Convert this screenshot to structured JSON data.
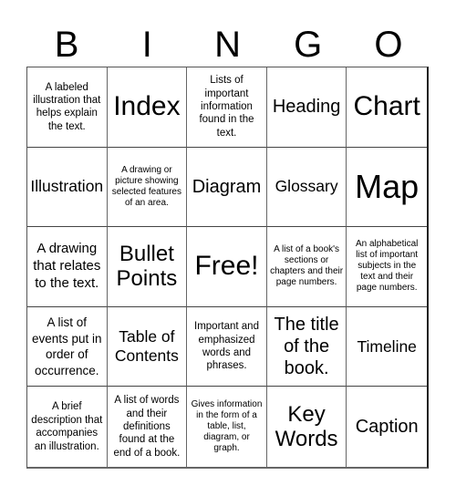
{
  "header": {
    "letters": [
      "B",
      "I",
      "N",
      "G",
      "O"
    ]
  },
  "cells": [
    {
      "text": "A labeled illustration that helps explain the text.",
      "size": "sz-s"
    },
    {
      "text": "Index",
      "size": "sz-xxl"
    },
    {
      "text": "Lists of important information found in the text.",
      "size": "sz-s"
    },
    {
      "text": "Heading",
      "size": "sz-lx"
    },
    {
      "text": "Chart",
      "size": "sz-xxl"
    },
    {
      "text": "Illustration",
      "size": "sz-l"
    },
    {
      "text": "A drawing or picture showing selected features of an area.",
      "size": "sz-xs"
    },
    {
      "text": "Diagram",
      "size": "sz-lx"
    },
    {
      "text": "Glossary",
      "size": "sz-l"
    },
    {
      "text": "Map",
      "size": "sz-xxxl"
    },
    {
      "text": "A drawing that relates to the text.",
      "size": "sz-ml"
    },
    {
      "text": "Bullet Points",
      "size": "sz-xl"
    },
    {
      "text": "Free!",
      "size": "sz-xxl"
    },
    {
      "text": "A list of a book's sections or chapters and their page numbers.",
      "size": "sz-xs"
    },
    {
      "text": "An alphabetical list of important subjects in the text and their page numbers.",
      "size": "sz-xs"
    },
    {
      "text": "A list of events put in order of occurrence.",
      "size": "sz-m"
    },
    {
      "text": "Table of Contents",
      "size": "sz-l"
    },
    {
      "text": "Important and emphasized words and phrases.",
      "size": "sz-s"
    },
    {
      "text": "The title of the book.",
      "size": "sz-lx"
    },
    {
      "text": "Timeline",
      "size": "sz-l"
    },
    {
      "text": "A brief description that accompanies an illustration.",
      "size": "sz-s"
    },
    {
      "text": "A list of words and their definitions found at the end of a book.",
      "size": "sz-s"
    },
    {
      "text": "Gives information in the form of a table, list, diagram, or graph.",
      "size": "sz-xs"
    },
    {
      "text": "Key Words",
      "size": "sz-xl"
    },
    {
      "text": "Caption",
      "size": "sz-lx"
    }
  ]
}
